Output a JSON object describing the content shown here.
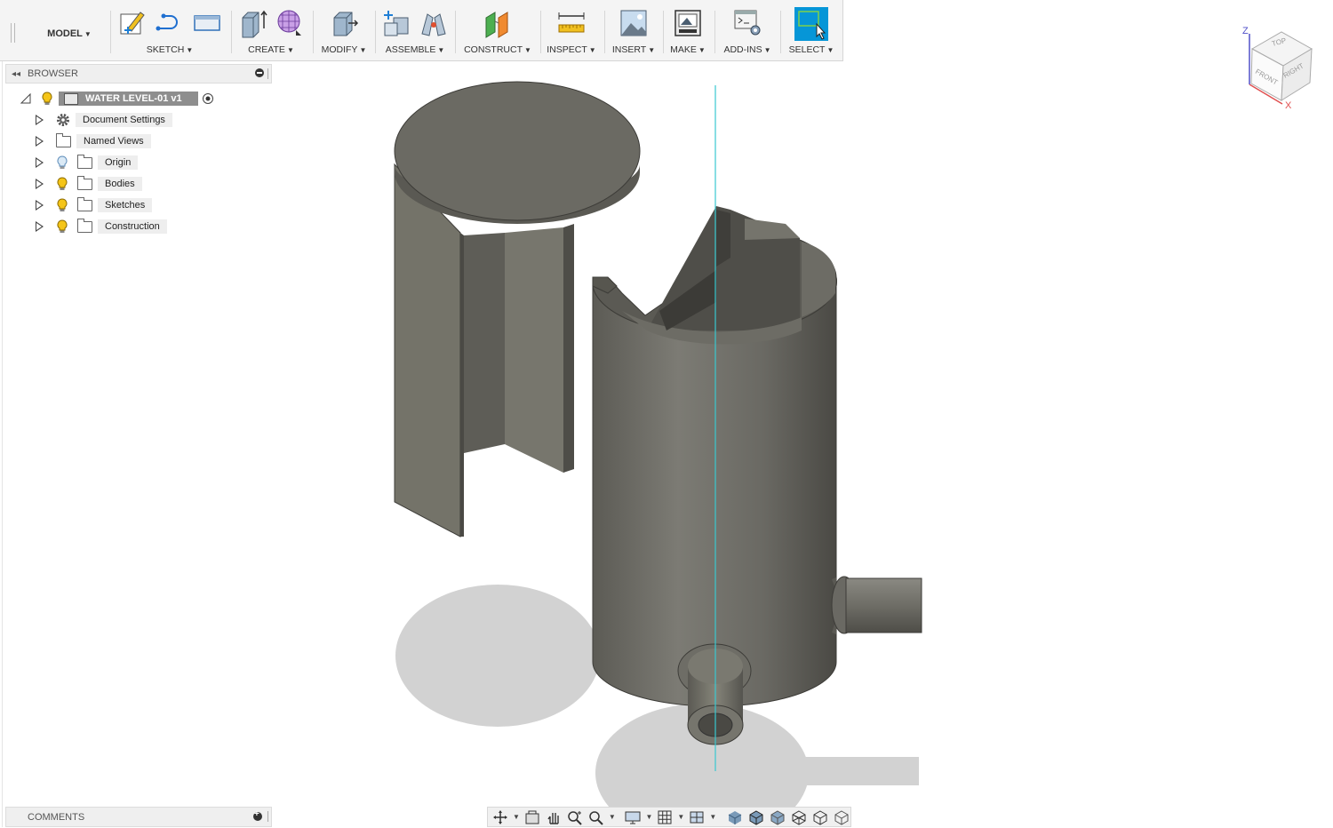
{
  "workspace": {
    "label": "MODEL"
  },
  "toolbar": {
    "groups": [
      {
        "label": "SKETCH"
      },
      {
        "label": "CREATE"
      },
      {
        "label": "MODIFY"
      },
      {
        "label": "ASSEMBLE"
      },
      {
        "label": "CONSTRUCT"
      },
      {
        "label": "INSPECT"
      },
      {
        "label": "INSERT"
      },
      {
        "label": "MAKE"
      },
      {
        "label": "ADD-INS"
      },
      {
        "label": "SELECT"
      }
    ]
  },
  "browser": {
    "title": "BROWSER",
    "root": {
      "label": "WATER LEVEL-01 v1"
    },
    "items": [
      {
        "label": "Document Settings",
        "icon": "gear-icon"
      },
      {
        "label": "Named Views",
        "icon": "folder-icon"
      },
      {
        "label": "Origin",
        "icon": "folder-icon",
        "visibility": "hidden"
      },
      {
        "label": "Bodies",
        "icon": "folder-icon",
        "visibility": "visible"
      },
      {
        "label": "Sketches",
        "icon": "folder-icon",
        "visibility": "visible"
      },
      {
        "label": "Construction",
        "icon": "folder-icon",
        "visibility": "visible"
      }
    ]
  },
  "viewcube": {
    "top": "TOP",
    "front": "FRONT",
    "right": "RIGHT",
    "axis_z": "Z",
    "axis_x": "X"
  },
  "comments": {
    "title": "COMMENTS"
  },
  "colors": {
    "accent": "#0696d7",
    "axis_line": "#38c8d0",
    "model": "#6e6d66",
    "bulb_on": "#f5c518",
    "bulb_off": "#9ec9e8"
  }
}
